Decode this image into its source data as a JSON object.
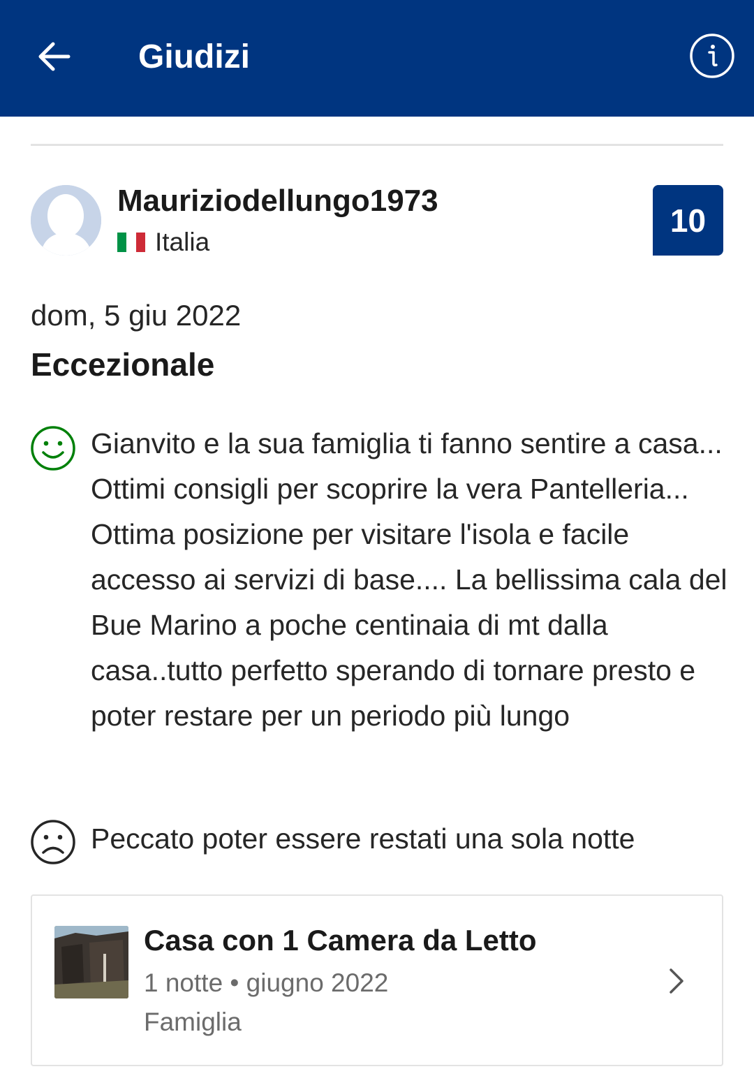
{
  "header": {
    "title": "Giudizi",
    "back_icon": "arrow-left-icon",
    "info_icon": "info-circle-icon",
    "background_color": "#003580"
  },
  "review": {
    "reviewer": {
      "name": "Mauriziodellungo1973",
      "country": "Italia",
      "avatar_icon": "default-avatar-icon",
      "flag_icon": "italy-flag-icon"
    },
    "score": "10",
    "date": "dom, 5 giu 2022",
    "headline": "Eccezionale",
    "positive": {
      "icon": "smiley-happy-icon",
      "text": "Gianvito e la sua famiglia ti fanno sentire a casa... Ottimi consigli per scoprire la vera Pantelleria... Ottima posizione per visitare l'isola e facile accesso ai servizi di base.... La bellissima cala del Bue Marino a poche centinaia di mt dalla casa..tutto perfetto sperando di tornare presto e poter restare per un periodo più lungo"
    },
    "negative": {
      "icon": "smiley-sad-icon",
      "text": "Peccato poter essere restati una sola notte"
    },
    "stay": {
      "room": "Casa con 1 Camera da Letto",
      "details": "1 notte • giugno 2022",
      "traveler_type": "Famiglia",
      "thumbnail_icon": "room-photo-thumbnail",
      "chevron_icon": "chevron-right-icon"
    }
  },
  "colors": {
    "brand": "#003580",
    "positive": "#008009",
    "text": "#262626",
    "muted": "#6b6b6b",
    "divider": "#e3e3e3"
  }
}
